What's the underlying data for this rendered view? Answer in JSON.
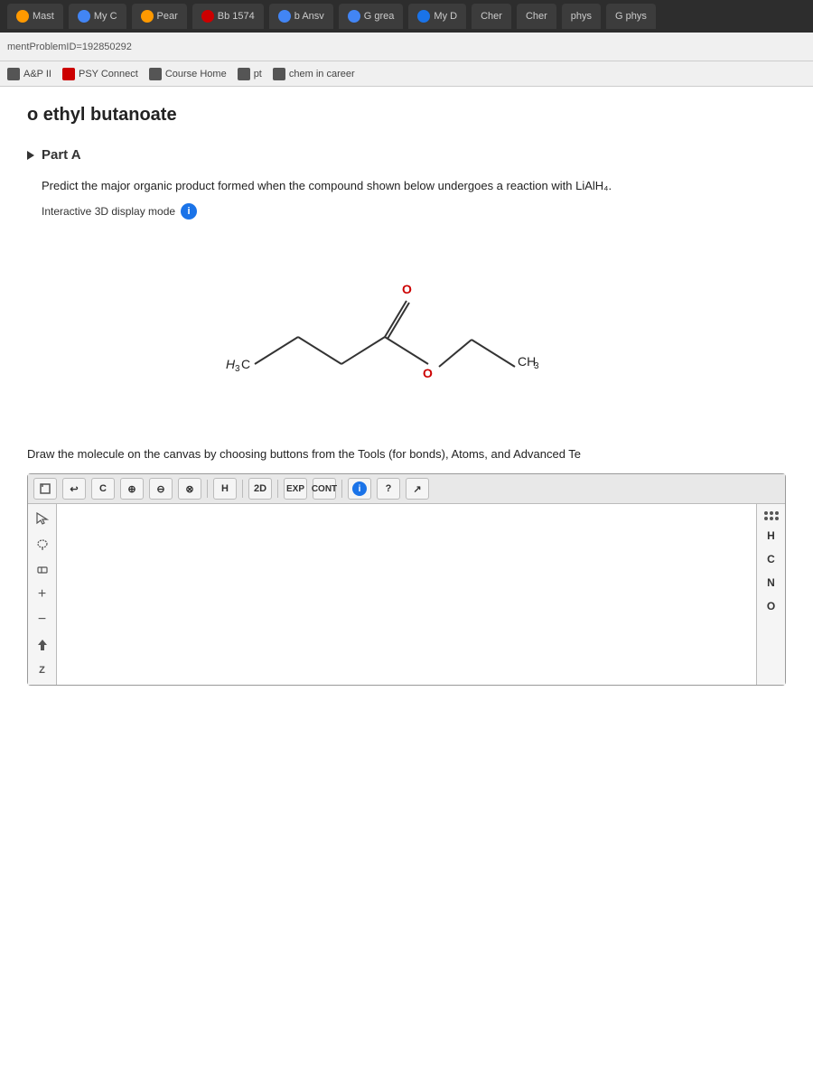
{
  "browser": {
    "tabs": [
      {
        "label": "Mast",
        "active": false
      },
      {
        "label": "My C",
        "active": false
      },
      {
        "label": "Pear",
        "active": false
      },
      {
        "label": "Bb 1574",
        "active": false
      },
      {
        "label": "b Ansv",
        "active": false
      },
      {
        "label": "G grea",
        "active": false
      },
      {
        "label": "My D",
        "active": false
      },
      {
        "label": "Cher",
        "active": false
      },
      {
        "label": "Cher",
        "active": false
      },
      {
        "label": "phys",
        "active": false
      },
      {
        "label": "G phys",
        "active": false
      }
    ],
    "problem_id": "mentProblemID=192850292"
  },
  "bookmarks": {
    "items": [
      {
        "label": "A&P II"
      },
      {
        "label": "PSY Connect"
      },
      {
        "label": "Course Home"
      },
      {
        "label": "pt"
      },
      {
        "label": "chem in career"
      }
    ]
  },
  "page": {
    "title": "o ethyl butanoate",
    "part_label": "Part A",
    "question": "Predict the major organic product formed when the compound shown below undergoes a reaction with LiAlH₄.",
    "display_mode": "Interactive 3D display mode",
    "draw_instruction": "Draw the molecule on the canvas by choosing buttons from the Tools (for bonds), Atoms, and Advanced Te"
  },
  "molecule": {
    "left_label": "H₃C",
    "right_label": "CH₃"
  },
  "toolbar": {
    "buttons": [
      "↩",
      "C",
      "⊕",
      "⊖",
      "⊗",
      "H",
      "2D",
      "EXP",
      "CONT",
      "ℹ",
      "?",
      "↗"
    ]
  },
  "right_panel": {
    "labels": [
      "H",
      "C",
      "N",
      "O"
    ]
  }
}
